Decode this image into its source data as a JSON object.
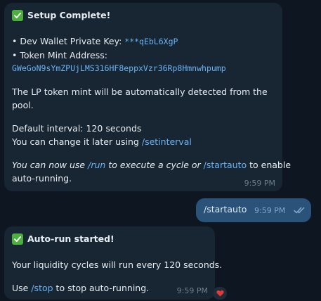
{
  "colors": {
    "background": "#0e1621",
    "incoming_bubble": "#182533",
    "outgoing_bubble": "#2b5278",
    "link": "#6ab3f3",
    "check_emoji": "#4caf3e",
    "heart": "#e53935"
  },
  "icons": {
    "check": "white-check-mark-emoji",
    "read_receipt": "double-check-icon",
    "reaction": "red-heart"
  },
  "messages": {
    "setup": {
      "title": "Setup Complete!",
      "bullet_wallet_label": "• Dev Wallet Private Key:",
      "bullet_wallet_value": "***qEbL6XgP",
      "bullet_mint_label": "• Token Mint Address:",
      "mint_address": "GWeGoN9sYmZPUjLMS316HF8eppxVzr36Rp8Hmnwhpump",
      "lp_note_line1": "The LP token mint will be automatically detected from the",
      "lp_note_line2": "pool.",
      "default_interval": "Default interval: 120 seconds",
      "change_prefix": "You can change it later using",
      "change_command": "/setinterval",
      "usage_prefix": "You can now use",
      "usage_run": "/run",
      "usage_middle": "to execute a cycle or",
      "usage_startauto": "/startauto",
      "usage_suffix": "to enable",
      "usage_line2": "auto-running.",
      "time": "9:59 PM"
    },
    "command": {
      "text": "/startauto",
      "time": "9:59 PM"
    },
    "autorun": {
      "title": "Auto-run started!",
      "cycles_text": "Your liquidity cycles will run every 120 seconds.",
      "use_prefix": "Use",
      "stop_command": "/stop",
      "use_suffix": "to stop auto-running.",
      "time": "9:59 PM"
    }
  }
}
